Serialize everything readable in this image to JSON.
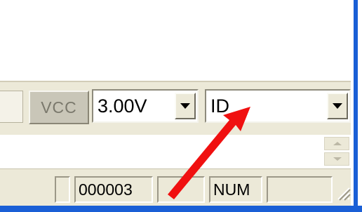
{
  "toolbar": {
    "vcc_label": "VCC",
    "voltage_combo": {
      "value": "3.00V"
    },
    "id_combo": {
      "value": "ID"
    }
  },
  "statusbar": {
    "counter": "000003",
    "num_indicator": "NUM"
  },
  "annotation": {
    "arrow_color": "#f01010"
  },
  "icons": [
    "chevron-down-icon",
    "scroll-up-icon",
    "scroll-down-icon",
    "resize-grip-icon",
    "annotation-arrow-icon"
  ]
}
